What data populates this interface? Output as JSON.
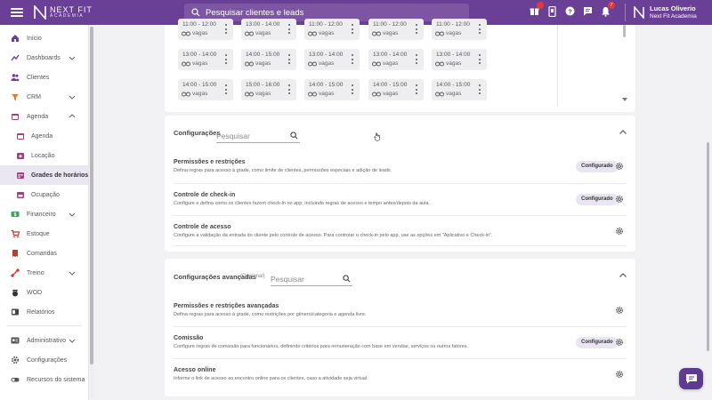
{
  "header": {
    "brand_line1": "NEXT FIT",
    "brand_line2": "ACADEMIA",
    "search_placeholder": "Pesquisar clientes e leads",
    "icons": [
      "gift-icon",
      "tablet-icon",
      "help-icon",
      "chat-icon",
      "bell-icon"
    ],
    "notification_count": "7",
    "user_name": "Lucas Oliverio",
    "user_company": "Next Fit Academia",
    "accent_color": "#6a3f96"
  },
  "sidebar": {
    "items": [
      {
        "label": "Início",
        "icon": "home-icon"
      },
      {
        "label": "Dashboards",
        "icon": "chart-icon",
        "expandable": true
      },
      {
        "label": "Clientes",
        "icon": "people-icon"
      },
      {
        "label": "CRM",
        "icon": "crm-icon",
        "expandable": true
      },
      {
        "label": "Agenda",
        "icon": "calendar-icon",
        "expanded": true
      },
      {
        "label": "Agenda",
        "icon": "calendar-icon",
        "sub": true
      },
      {
        "label": "Locação",
        "icon": "location-icon",
        "sub": true
      },
      {
        "label": "Grades de horários",
        "icon": "schedule-grid-icon",
        "sub": true,
        "active": true
      },
      {
        "label": "Ocupação",
        "icon": "occupancy-icon",
        "sub": true
      },
      {
        "label": "Financeiro",
        "icon": "money-icon",
        "expandable": true
      },
      {
        "label": "Estoque",
        "icon": "cart-icon"
      },
      {
        "label": "Comandas",
        "icon": "receipt-icon"
      },
      {
        "label": "Treino",
        "icon": "dumbbell-icon",
        "expandable": true
      },
      {
        "label": "WOD",
        "icon": "kettlebell-icon"
      },
      {
        "label": "Relatórios",
        "icon": "report-icon"
      },
      {
        "label": "Administrativo",
        "icon": "admin-icon",
        "expandable": true
      },
      {
        "label": "Configurações",
        "icon": "gear-icon"
      },
      {
        "label": "Recursos do sistema",
        "icon": "toggle-icon"
      }
    ]
  },
  "schedule": {
    "vacancy_label": "vagas",
    "rows": [
      [
        "11:00 - 12:00",
        "13:00 - 14:00",
        "11:00 - 12:00",
        "11:00 - 12:00",
        "11:00 - 12:00"
      ],
      [
        "13:00 - 14:00",
        "14:00 - 15:00",
        "13:00 - 14:00",
        "13:00 - 14:00",
        "13:00 - 14:00"
      ],
      [
        "14:00 - 15:00",
        "15:00 - 16:00",
        "14:00 - 15:00",
        "14:00 - 15:00",
        "14:00 - 15:00"
      ]
    ]
  },
  "config": {
    "title": "Configurações",
    "search_placeholder": "Pesquisar",
    "rows": [
      {
        "title": "Permissões e restrições",
        "desc": "Defina regras para acesso à grade, como limite de clientes, permissões especiais e adição de leads.",
        "button": "Configurado"
      },
      {
        "title": "Controle de check-in",
        "desc": "Configure e defina como os clientes fazem check-in no app, incluindo regras de acesso e tempo antes/depois da aula.",
        "button": "Configurado"
      },
      {
        "title": "Controle de acesso",
        "desc": "Configure a validação da entrada do cliente pelo controle de acesso. Para controlar o check-in pelo app, use as opções em \"Aplicativo e Check-in\"."
      }
    ]
  },
  "advanced": {
    "title": "Configurações avançadas",
    "optional": "(Opcional)",
    "search_placeholder": "Pesquisar",
    "rows": [
      {
        "title": "Permissões e restrições avançadas",
        "desc": "Defina regras para acesso à grade, como restrições por gênero/categoria e agenda livre."
      },
      {
        "title": "Comissão",
        "desc": "Configure regras de comissão para funcionários, definindo critérios para remuneração com base em vendas, serviços ou outros fatores.",
        "button": "Configurado"
      },
      {
        "title": "Acesso online",
        "desc": "Informe o link de acesso ao encontro online para os clientes, caso a atividade seja virtual."
      }
    ]
  }
}
